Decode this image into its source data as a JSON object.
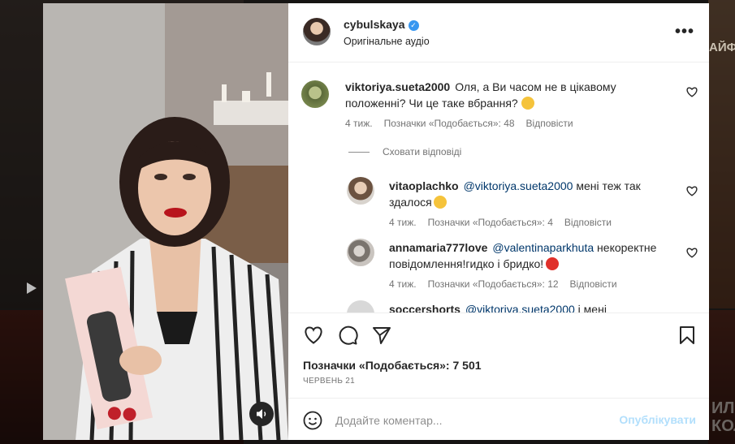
{
  "post": {
    "username": "cybulskaya",
    "audio": "Оригінальне аудіо",
    "likes_text": "Позначки «Подобається»: 7 501",
    "date": "ЧЕРВЕНЬ 21"
  },
  "comments": [
    {
      "username": "viktoriya.sueta2000",
      "text": "Оля, а Ви часом не в цікавому положенні? Чи це таке вбрання?",
      "age": "4 тиж.",
      "likes": "Позначки «Подобається»: 48",
      "reply": "Відповісти"
    }
  ],
  "hide_replies": "Сховати відповіді",
  "replies": [
    {
      "username": "vitaoplachko",
      "mention": "@viktoriya.sueta2000",
      "text_line1": "мені теж так",
      "text_line2": "здалося",
      "age": "4 тиж.",
      "likes": "Позначки «Подобається»: 4",
      "reply": "Відповісти"
    },
    {
      "username": "annamaria777love",
      "mention": "@valentinaparkhuta",
      "text_line1": "некоректне",
      "text_line2": "повідомлення!гидко і бридко!",
      "age": "4 тиж.",
      "likes": "Позначки «Подобається»: 12",
      "reply": "Відповісти"
    },
    {
      "username": "soccershorts",
      "mention": "@viktoriya.sueta2000",
      "text_line1": "і мені"
    }
  ],
  "composer": {
    "placeholder": "Додайте коментар...",
    "publish": "Опублікувати"
  },
  "background": {
    "right_text": "АЙФХА",
    "right_bottom_text": "ИЛА\nКОЛО"
  }
}
